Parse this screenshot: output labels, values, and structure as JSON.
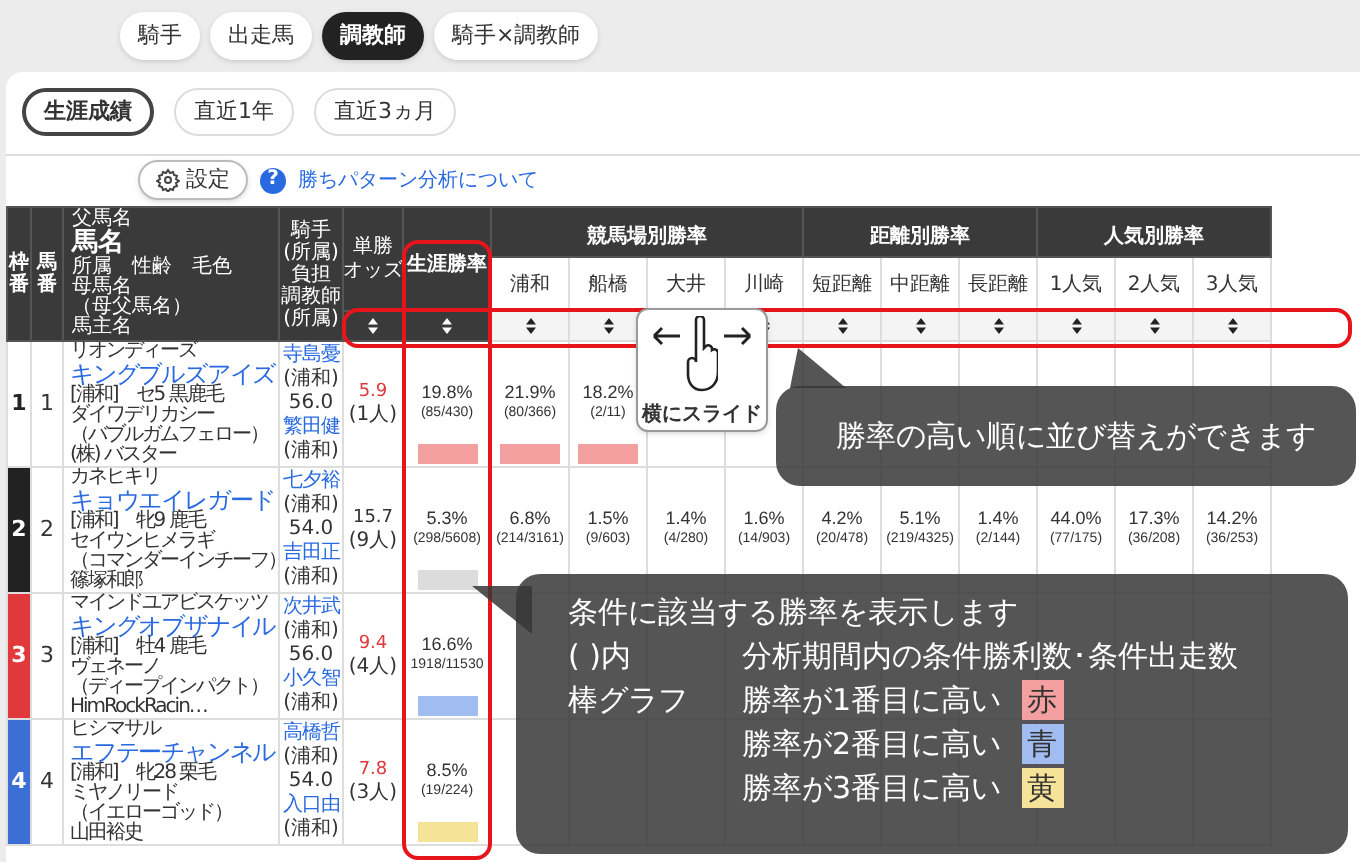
{
  "top_tabs": [
    {
      "label": "騎手",
      "selected": false
    },
    {
      "label": "出走馬",
      "selected": false
    },
    {
      "label": "調教師",
      "selected": true
    },
    {
      "label": "騎手×調教師",
      "selected": false
    }
  ],
  "period_tabs": [
    {
      "label": "生涯成績",
      "selected": true
    },
    {
      "label": "直近1年",
      "selected": false
    },
    {
      "label": "直近3ヵ月",
      "selected": false
    }
  ],
  "settings_button": "設定",
  "help": {
    "icon": "?",
    "label": "勝ちパターン分析について"
  },
  "table": {
    "header": {
      "frame": "枠番",
      "number": "馬番",
      "horse": [
        "父馬名",
        "馬名",
        "所属　性齢　毛色",
        "母馬名",
        "（母父馬名）",
        "馬主名"
      ],
      "jockey": [
        "騎手",
        "(所属)",
        "負担",
        "調教師",
        "(所属)"
      ],
      "odds": [
        "単勝",
        "オッズ"
      ],
      "lifetime": "生涯勝率"
    },
    "groups": [
      {
        "label": "競馬場別勝率",
        "columns": [
          "浦和",
          "船橋",
          "大井",
          "川崎"
        ]
      },
      {
        "label": "距離別勝率",
        "columns": [
          "短距離",
          "中距離",
          "長距離"
        ]
      },
      {
        "label": "人気別勝率",
        "columns": [
          "1人気",
          "2人気",
          "3人気"
        ]
      }
    ],
    "rows": [
      {
        "frame": {
          "number": "1",
          "color": "#ffffff"
        },
        "number": "1",
        "horse": {
          "sire": "リオンディーズ",
          "name": "キングブルズアイズ",
          "info": "[浦和]　セ5 黒鹿毛",
          "dam": "ダイワデリカシー",
          "damsire": "（バブルガムフェロー）",
          "owner": "(株) バスター"
        },
        "jockey": {
          "name": "寺島憂",
          "affiliation": "(浦和)",
          "weight": "56.0",
          "trainer": "繁田健",
          "trainer_affiliation": "(浦和)"
        },
        "odds": {
          "value": "5.9",
          "rank": "(1人)",
          "highlight": true
        },
        "rates": [
          {
            "rate": "19.8%",
            "count": "(85/430)",
            "color": "#f4a0a0"
          },
          {
            "rate": "21.9%",
            "count": "(80/366)",
            "color": "#f4a0a0"
          },
          {
            "rate": "18.2%",
            "count": "(2/11)",
            "color": "#f4a0a0"
          }
        ]
      },
      {
        "frame": {
          "number": "2",
          "color": "#222222"
        },
        "number": "2",
        "horse": {
          "sire": "カネヒキリ",
          "name": "キョウエイレガード",
          "info": "[浦和]　牝9 鹿毛",
          "dam": "セイウンヒメラギ",
          "damsire": "（コマンダーインチーフ）",
          "owner": "篠塚和郎"
        },
        "jockey": {
          "name": "七夕裕",
          "affiliation": "(浦和)",
          "weight": "54.0",
          "trainer": "吉田正",
          "trainer_affiliation": "(浦和)"
        },
        "odds": {
          "value": "15.7",
          "rank": "(9人)",
          "highlight": false
        },
        "rates": [
          {
            "rate": "5.3%",
            "count": "(298/5608)",
            "color": "#dcdcdc"
          },
          {
            "rate": "6.8%",
            "count": "(214/3161)"
          },
          {
            "rate": "1.5%",
            "count": "(9/603)"
          },
          {
            "rate": "1.4%",
            "count": "(4/280)"
          },
          {
            "rate": "1.6%",
            "count": "(14/903)"
          },
          {
            "rate": "4.2%",
            "count": "(20/478)"
          },
          {
            "rate": "5.1%",
            "count": "(219/4325)"
          },
          {
            "rate": "1.4%",
            "count": "(2/144)"
          },
          {
            "rate": "44.0%",
            "count": "(77/175)"
          },
          {
            "rate": "17.3%",
            "count": "(36/208)"
          },
          {
            "rate": "14.2%",
            "count": "(36/253)"
          }
        ]
      },
      {
        "frame": {
          "number": "3",
          "color": "#e0383b"
        },
        "number": "3",
        "horse": {
          "sire": "マインドユアビスケッツ",
          "name": "キングオブザナイル",
          "info": "[浦和]　牡4 鹿毛",
          "dam": "ヴェネーノ",
          "damsire": "（ディープインパクト）",
          "owner": "HimRockRacin…"
        },
        "jockey": {
          "name": "次井武",
          "affiliation": "(浦和)",
          "weight": "56.0",
          "trainer": "小久智",
          "trainer_affiliation": "(浦和)"
        },
        "odds": {
          "value": "9.4",
          "rank": "(4人)",
          "highlight": true
        },
        "rates": [
          {
            "rate": "16.6%",
            "count": "1918/11530",
            "color": "#a0bcf0"
          }
        ]
      },
      {
        "frame": {
          "number": "4",
          "color": "#3b6fd6"
        },
        "number": "4",
        "horse": {
          "sire": "ヒシマサル",
          "name": "エフテーチャンネル",
          "info": "[浦和]　牝28 栗毛",
          "dam": "ミヤノリード",
          "damsire": "（イエローゴッド）",
          "owner": "山田裕史"
        },
        "jockey": {
          "name": "高橋哲",
          "affiliation": "(浦和)",
          "weight": "54.0",
          "trainer": "入口由",
          "trainer_affiliation": "(浦和)"
        },
        "odds": {
          "value": "7.8",
          "rank": "(3人)",
          "highlight": true
        },
        "rates": [
          {
            "rate": "8.5%",
            "count": "(19/224)",
            "color": "#f6e39a"
          }
        ]
      }
    ]
  },
  "slide_hint": "横にスライド",
  "sort_tooltip": "勝率の高い順に並び替えができます",
  "legend_tooltip": {
    "title": "条件に該当する勝率を表示します",
    "bracket_label": "( )内",
    "bracket_text": "分析期間内の条件勝利数･条件出走数",
    "bar_label": "棒グラフ",
    "items": [
      {
        "text": "勝率が1番目に高い",
        "swatch": "赤",
        "color": "#f4a0a0"
      },
      {
        "text": "勝率が2番目に高い",
        "swatch": "青",
        "color": "#a0bcf0"
      },
      {
        "text": "勝率が3番目に高い",
        "swatch": "黄",
        "color": "#f6e39a"
      }
    ]
  }
}
